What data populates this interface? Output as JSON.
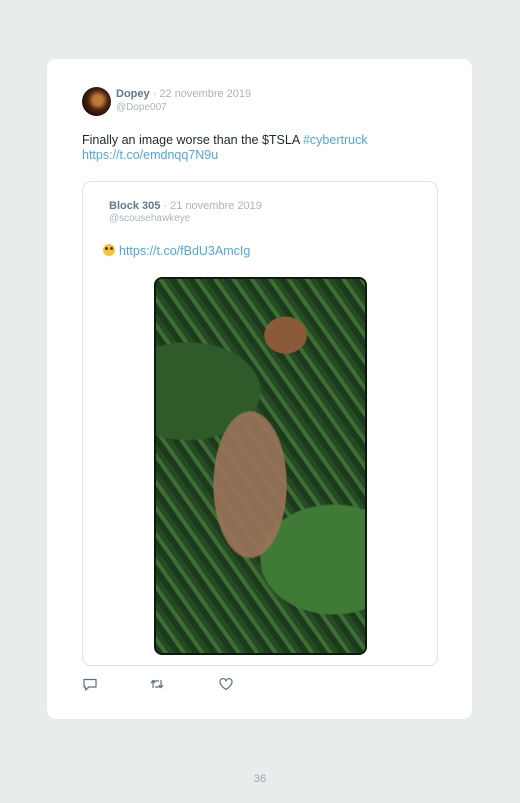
{
  "tweet": {
    "author_name": "Dopey",
    "date": " · 22 novembre 2019",
    "handle": "@Dope007",
    "text_prefix": "Finally an image worse than the $TSLA ",
    "hashtag": "#cybertruck",
    "link": "https://t.co/emdnqq7N9u"
  },
  "quoted_tweet": {
    "author_name": "Block 305",
    "date": " · 21 novembre 2019",
    "handle": "@scousehawkeye",
    "emoji_icon": "flushed-face-icon",
    "link": "https://t.co/fBdU3AmcIg"
  },
  "actions": [
    {
      "icon": "reply-icon"
    },
    {
      "icon": "retweet-icon"
    },
    {
      "icon": "heart-icon"
    }
  ],
  "page_number": "36",
  "colors": {
    "background": "#e9ecec",
    "card": "#ffffff",
    "link": "#4fa8dc",
    "name": "#65778a",
    "muted": "#aab4bc"
  }
}
